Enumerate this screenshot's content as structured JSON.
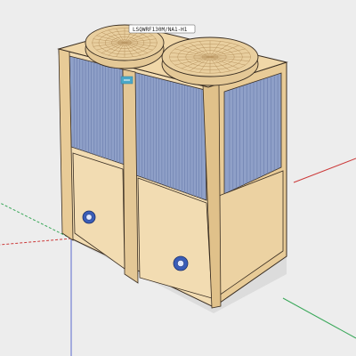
{
  "model_label": "LSQWRF130M/NA1-H1",
  "colors": {
    "background": "#ededed",
    "casing": "#f2dcb2",
    "casing_shade": "#e4c896",
    "casing_dark": "#caa874",
    "outline": "#3a2e22",
    "coil": "#8fa0c8",
    "coil_dark": "#6f82b0",
    "fan_grille": "#e9cf9f",
    "logo": "#4aa8c8",
    "valve_blue": "#3a5db8",
    "axis_red": "#cc3a3a",
    "axis_green": "#3aa85a",
    "axis_blue": "#5a6ad0"
  },
  "icons": {
    "logo": "brand-logo-icon",
    "valve": "pipe-connector-icon",
    "fan": "fan-grille-icon"
  }
}
